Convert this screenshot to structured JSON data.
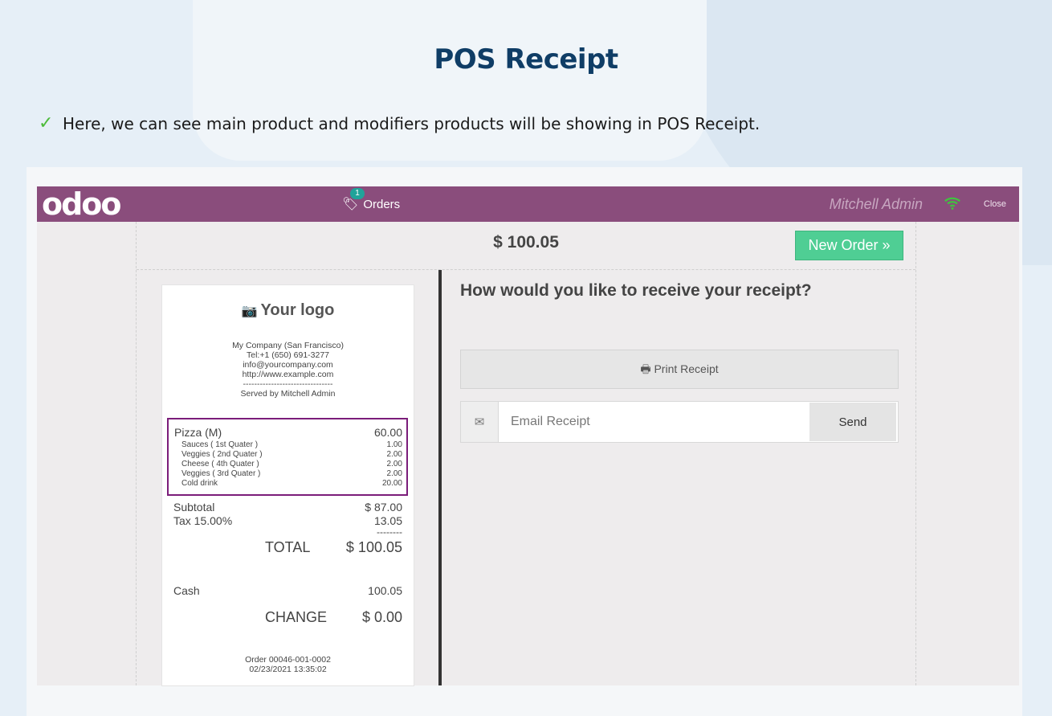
{
  "slide": {
    "title": "POS Receipt",
    "bullet": "Here, we can see main product and modifiers products will be showing in  POS Receipt."
  },
  "navbar": {
    "logo": "odoo",
    "orders_label": "Orders",
    "orders_badge": "1",
    "user": "Mitchell Admin",
    "close": "Close",
    "accent_color": "#8a4d7c"
  },
  "top": {
    "amount": "$ 100.05",
    "new_order": "New Order »"
  },
  "receipt": {
    "logo": "Your logo",
    "company": [
      "My Company (San Francisco)",
      "Tel:+1 (650) 691-3277",
      "info@yourcompany.com",
      "http://www.example.com",
      "--------------------------------",
      "Served by Mitchell Admin"
    ],
    "main_product": {
      "name": "Pizza (M)",
      "price": "60.00"
    },
    "modifiers": [
      {
        "name": "Sauces ( 1st Quater )",
        "price": "1.00"
      },
      {
        "name": "Veggies ( 2nd Quater )",
        "price": "2.00"
      },
      {
        "name": "Cheese ( 4th Quater )",
        "price": "2.00"
      },
      {
        "name": "Veggies ( 3rd Quater )",
        "price": "2.00"
      },
      {
        "name": "Cold drink",
        "price": "20.00"
      }
    ],
    "subtotal_label": "Subtotal",
    "subtotal_value": "$ 87.00",
    "tax_label": "Tax 15.00%",
    "tax_value": "13.05",
    "separator": "--------",
    "total_label": "TOTAL",
    "total_value": "$ 100.05",
    "cash_label": "Cash",
    "cash_value": "100.05",
    "change_label": "CHANGE",
    "change_value": "$ 0.00",
    "order_ref": "Order 00046-001-0002",
    "order_date": "02/23/2021 13:35:02"
  },
  "receive": {
    "question": "How would you like to receive your receipt?",
    "print_label": "Print Receipt",
    "email_placeholder": "Email Receipt",
    "send_label": "Send"
  }
}
